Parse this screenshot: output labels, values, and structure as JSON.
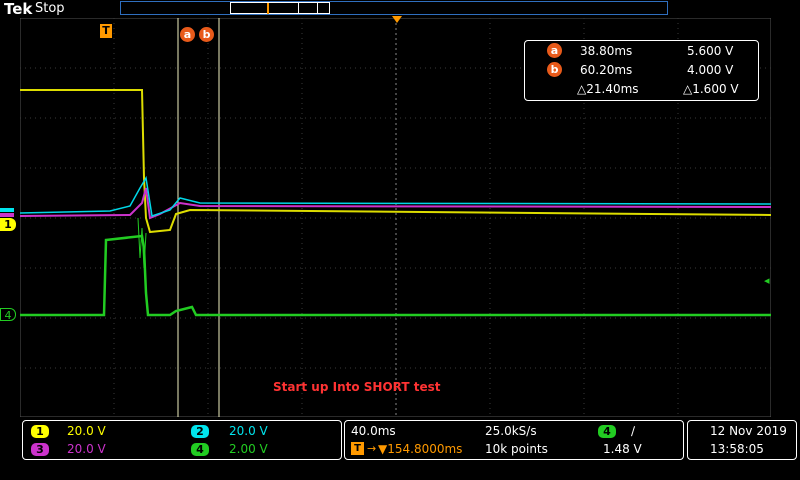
{
  "header": {
    "brand": "Tek",
    "status": "Stop",
    "trigger_marker": "T"
  },
  "markers": {
    "trigger": "T",
    "cursor_a": "a",
    "cursor_b": "b"
  },
  "cursor_readout": {
    "a_time": "38.80ms",
    "a_volt": "5.600 V",
    "b_time": "60.20ms",
    "b_volt": "4.000 V",
    "delta_time": "△21.40ms",
    "delta_volt": "△1.600 V"
  },
  "annotation": "Start up Into SHORT test",
  "channels": [
    {
      "id": "1",
      "scale": "20.0 V",
      "color": "#ffff00"
    },
    {
      "id": "2",
      "scale": "20.0 V",
      "color": "#00e5ee"
    },
    {
      "id": "3",
      "scale": "20.0 V",
      "color": "#cc33cc"
    },
    {
      "id": "4",
      "scale": "2.00 V",
      "color": "#22cc22"
    }
  ],
  "timebase": {
    "scale": "40.0ms",
    "sample_rate": "25.0kS/s",
    "position": "▼154.8000ms",
    "record_length": "10k points"
  },
  "trigger": {
    "source": "4",
    "slope": "∕",
    "level": "1.48 V"
  },
  "clock": {
    "date": "12 Nov 2019",
    "time": "13:58:05"
  }
}
